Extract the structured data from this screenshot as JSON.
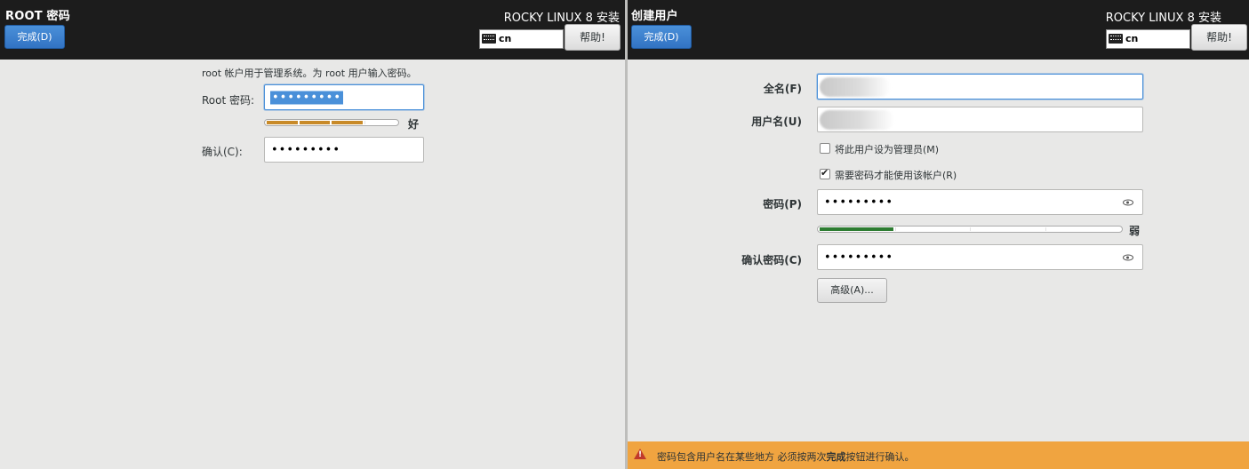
{
  "root_spoke": {
    "title": "ROOT 密码",
    "done_label": "完成(D)",
    "product": "ROCKY LINUX 8 安装",
    "keyboard_layout": "cn",
    "help_label": "帮助!",
    "description": "root 帐户用于管理系统。为 root 用户输入密码。",
    "password_label": "Root 密码:",
    "password_value": "•••••••••",
    "strength_label": "好",
    "strength_fraction": 0.75,
    "strength_color": "#c88a28",
    "confirm_label": "确认(C):",
    "confirm_value": "•••••••••"
  },
  "user_spoke": {
    "title": "创建用户",
    "done_label": "完成(D)",
    "product": "ROCKY LINUX 8 安装",
    "keyboard_layout": "cn",
    "help_label": "帮助!",
    "fullname_label": "全名(F)",
    "username_label": "用户名(U)",
    "admin_checkbox_label": "将此用户设为管理员(M)",
    "admin_checked": false,
    "require_password_label": "需要密码才能使用该帐户(R)",
    "require_password_checked": true,
    "password_label": "密码(P)",
    "password_value": "•••••••••",
    "strength_label": "弱",
    "strength_fraction": 0.25,
    "strength_color": "#2e7d32",
    "confirm_label": "确认密码(C)",
    "confirm_value": "•••••••••",
    "advanced_label": "高级(A)...",
    "warning_prefix": "密码包含用户名在某些地方 必须按两次",
    "warning_bold": "完成",
    "warning_suffix": "按钮进行确认。",
    "warning_color": "#f0a440"
  }
}
